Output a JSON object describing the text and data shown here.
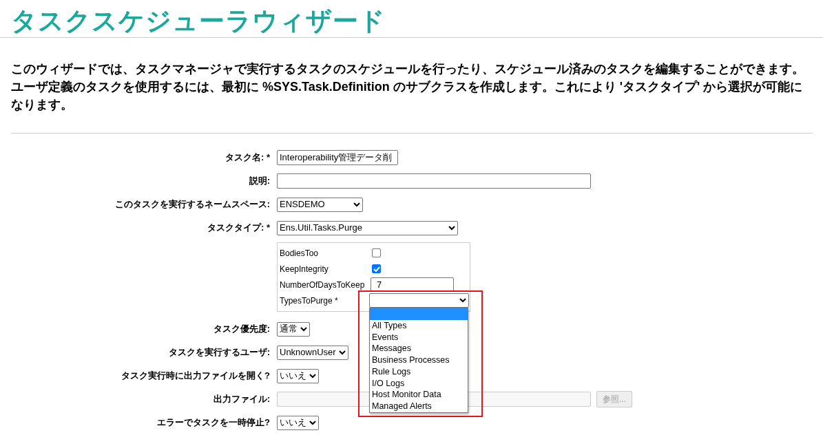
{
  "title": "タスクスケジューラウィザード",
  "intro": [
    "このウィザードでは、タスクマネージャで実行するタスクのスケジュールを行ったり、スケジュール済みのタスクを編集することができます。",
    "ユーザ定義のタスクを使用するには、最初に %SYS.Task.Definition のサブクラスを作成します。これにより 'タスクタイプ' から選択が可能になります。"
  ],
  "fields": [
    {
      "kind": "text",
      "label": "タスク名: *",
      "value": "Interoperability管理データ削"
    },
    {
      "kind": "text",
      "label": "説明:"
    },
    {
      "kind": "select",
      "label": "このタスクを実行するネームスペース:",
      "value": "ENSDEMO"
    },
    {
      "kind": "select",
      "label": "タスクタイプ: *",
      "value": "Ens.Util.Tasks.Purge"
    },
    {
      "kind": "params",
      "items": [
        {
          "kind": "checkbox",
          "label": "BodiesToo",
          "checked": false
        },
        {
          "kind": "checkbox",
          "label": "KeepIntegrity",
          "checked": true
        },
        {
          "kind": "text",
          "label": "NumberOfDaysToKeep",
          "value": "7"
        },
        {
          "kind": "select",
          "label": "TypesToPurge *",
          "expanded": true,
          "blank_highlighted": true,
          "options": [
            {
              "label": "All Types",
              "selected": false
            },
            {
              "label": "Events",
              "selected": false
            },
            {
              "label": "Messages",
              "selected": false
            },
            {
              "label": "Business Processes",
              "selected": false
            },
            {
              "label": "Rule Logs",
              "selected": false
            },
            {
              "label": "I/O Logs",
              "selected": false
            },
            {
              "label": "Host Monitor Data",
              "selected": false
            },
            {
              "label": "Managed Alerts",
              "selected": false
            }
          ]
        }
      ]
    },
    {
      "kind": "select",
      "label": "タスク優先度:",
      "value": "通常"
    },
    {
      "kind": "select",
      "label": "タスクを実行するユーザ:",
      "value": "UnknownUser"
    },
    {
      "kind": "select",
      "label": "タスク実行時に出力ファイルを開く?",
      "value": "いいえ"
    },
    {
      "kind": "file",
      "label": "出力ファイル:",
      "disabled": true,
      "button": "参照..."
    },
    {
      "kind": "select",
      "label": "エラーでタスクを一時停止?",
      "value": "いいえ"
    }
  ]
}
